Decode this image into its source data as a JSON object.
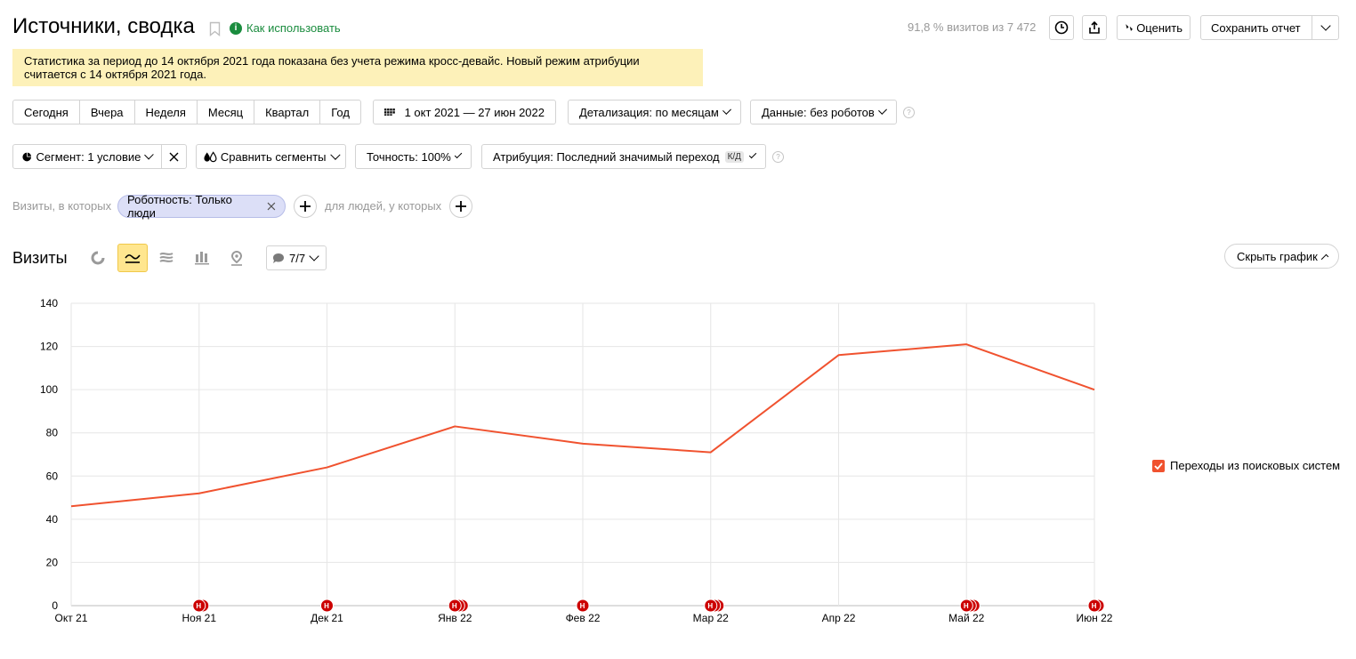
{
  "header": {
    "title": "Источники, сводка",
    "how_to_use": "Как использовать",
    "visits_share": "91,8 % визитов из 7 472",
    "rate_label": "Оценить",
    "save_report_label": "Сохранить отчет"
  },
  "notice": {
    "line1": "Статистика за период до 14 октября 2021 года показана без учета режима кросс-девайс. Новый режим атрибуции",
    "line2": "считается с 14 октября 2021 года.",
    "bg_color": "#fdf1b9"
  },
  "period": {
    "tabs": [
      "Сегодня",
      "Вчера",
      "Неделя",
      "Месяц",
      "Квартал",
      "Год"
    ],
    "date_range": "1 окт 2021 — 27 июн 2022",
    "detail": "Детализация: по месяцам",
    "data": "Данные: без роботов"
  },
  "filters": {
    "segment": "Сегмент: 1 условие",
    "compare": "Сравнить сегменты",
    "accuracy": "Точность: 100%",
    "attribution": "Атрибуция: Последний значимый переход",
    "attribution_badge": "К/Д"
  },
  "conditions": {
    "visits_where": "Визиты, в которых",
    "robot_chip": "Роботность: Только люди",
    "for_people": "для людей, у которых"
  },
  "chart_toolbar": {
    "title": "Визиты",
    "annotations": "7/7",
    "hide_chart": "Скрыть график"
  },
  "chart_data": {
    "type": "line",
    "categories": [
      "Окт 21",
      "Ноя 21",
      "Дек 21",
      "Янв 22",
      "Фев 22",
      "Мар 22",
      "Апр 22",
      "Май 22",
      "Июн 22"
    ],
    "ylim": [
      0,
      140
    ],
    "yticks": [
      0,
      20,
      40,
      60,
      80,
      100,
      120,
      140
    ],
    "series": [
      {
        "name": "Переходы из поисковых систем",
        "color": "#f0522f",
        "values": [
          46,
          52,
          64,
          83,
          75,
          71,
          116,
          121,
          100
        ]
      }
    ],
    "grid": true,
    "legend": "right",
    "markers": [
      {
        "label": "Н",
        "category": "Ноя 21",
        "stack": 2
      },
      {
        "label": "Н",
        "category": "Дек 21",
        "stack": 1
      },
      {
        "label": "Н",
        "category": "Янв 22",
        "stack": 3
      },
      {
        "label": "Н",
        "category": "Фев 22",
        "stack": 1
      },
      {
        "label": "Н",
        "category": "Мар 22",
        "stack": 3
      },
      {
        "label": "Н",
        "category": "Май 22",
        "stack": 3
      },
      {
        "label": "Н",
        "category": "Июн 22",
        "stack": 2
      }
    ],
    "marker_color": "#cc0000"
  }
}
